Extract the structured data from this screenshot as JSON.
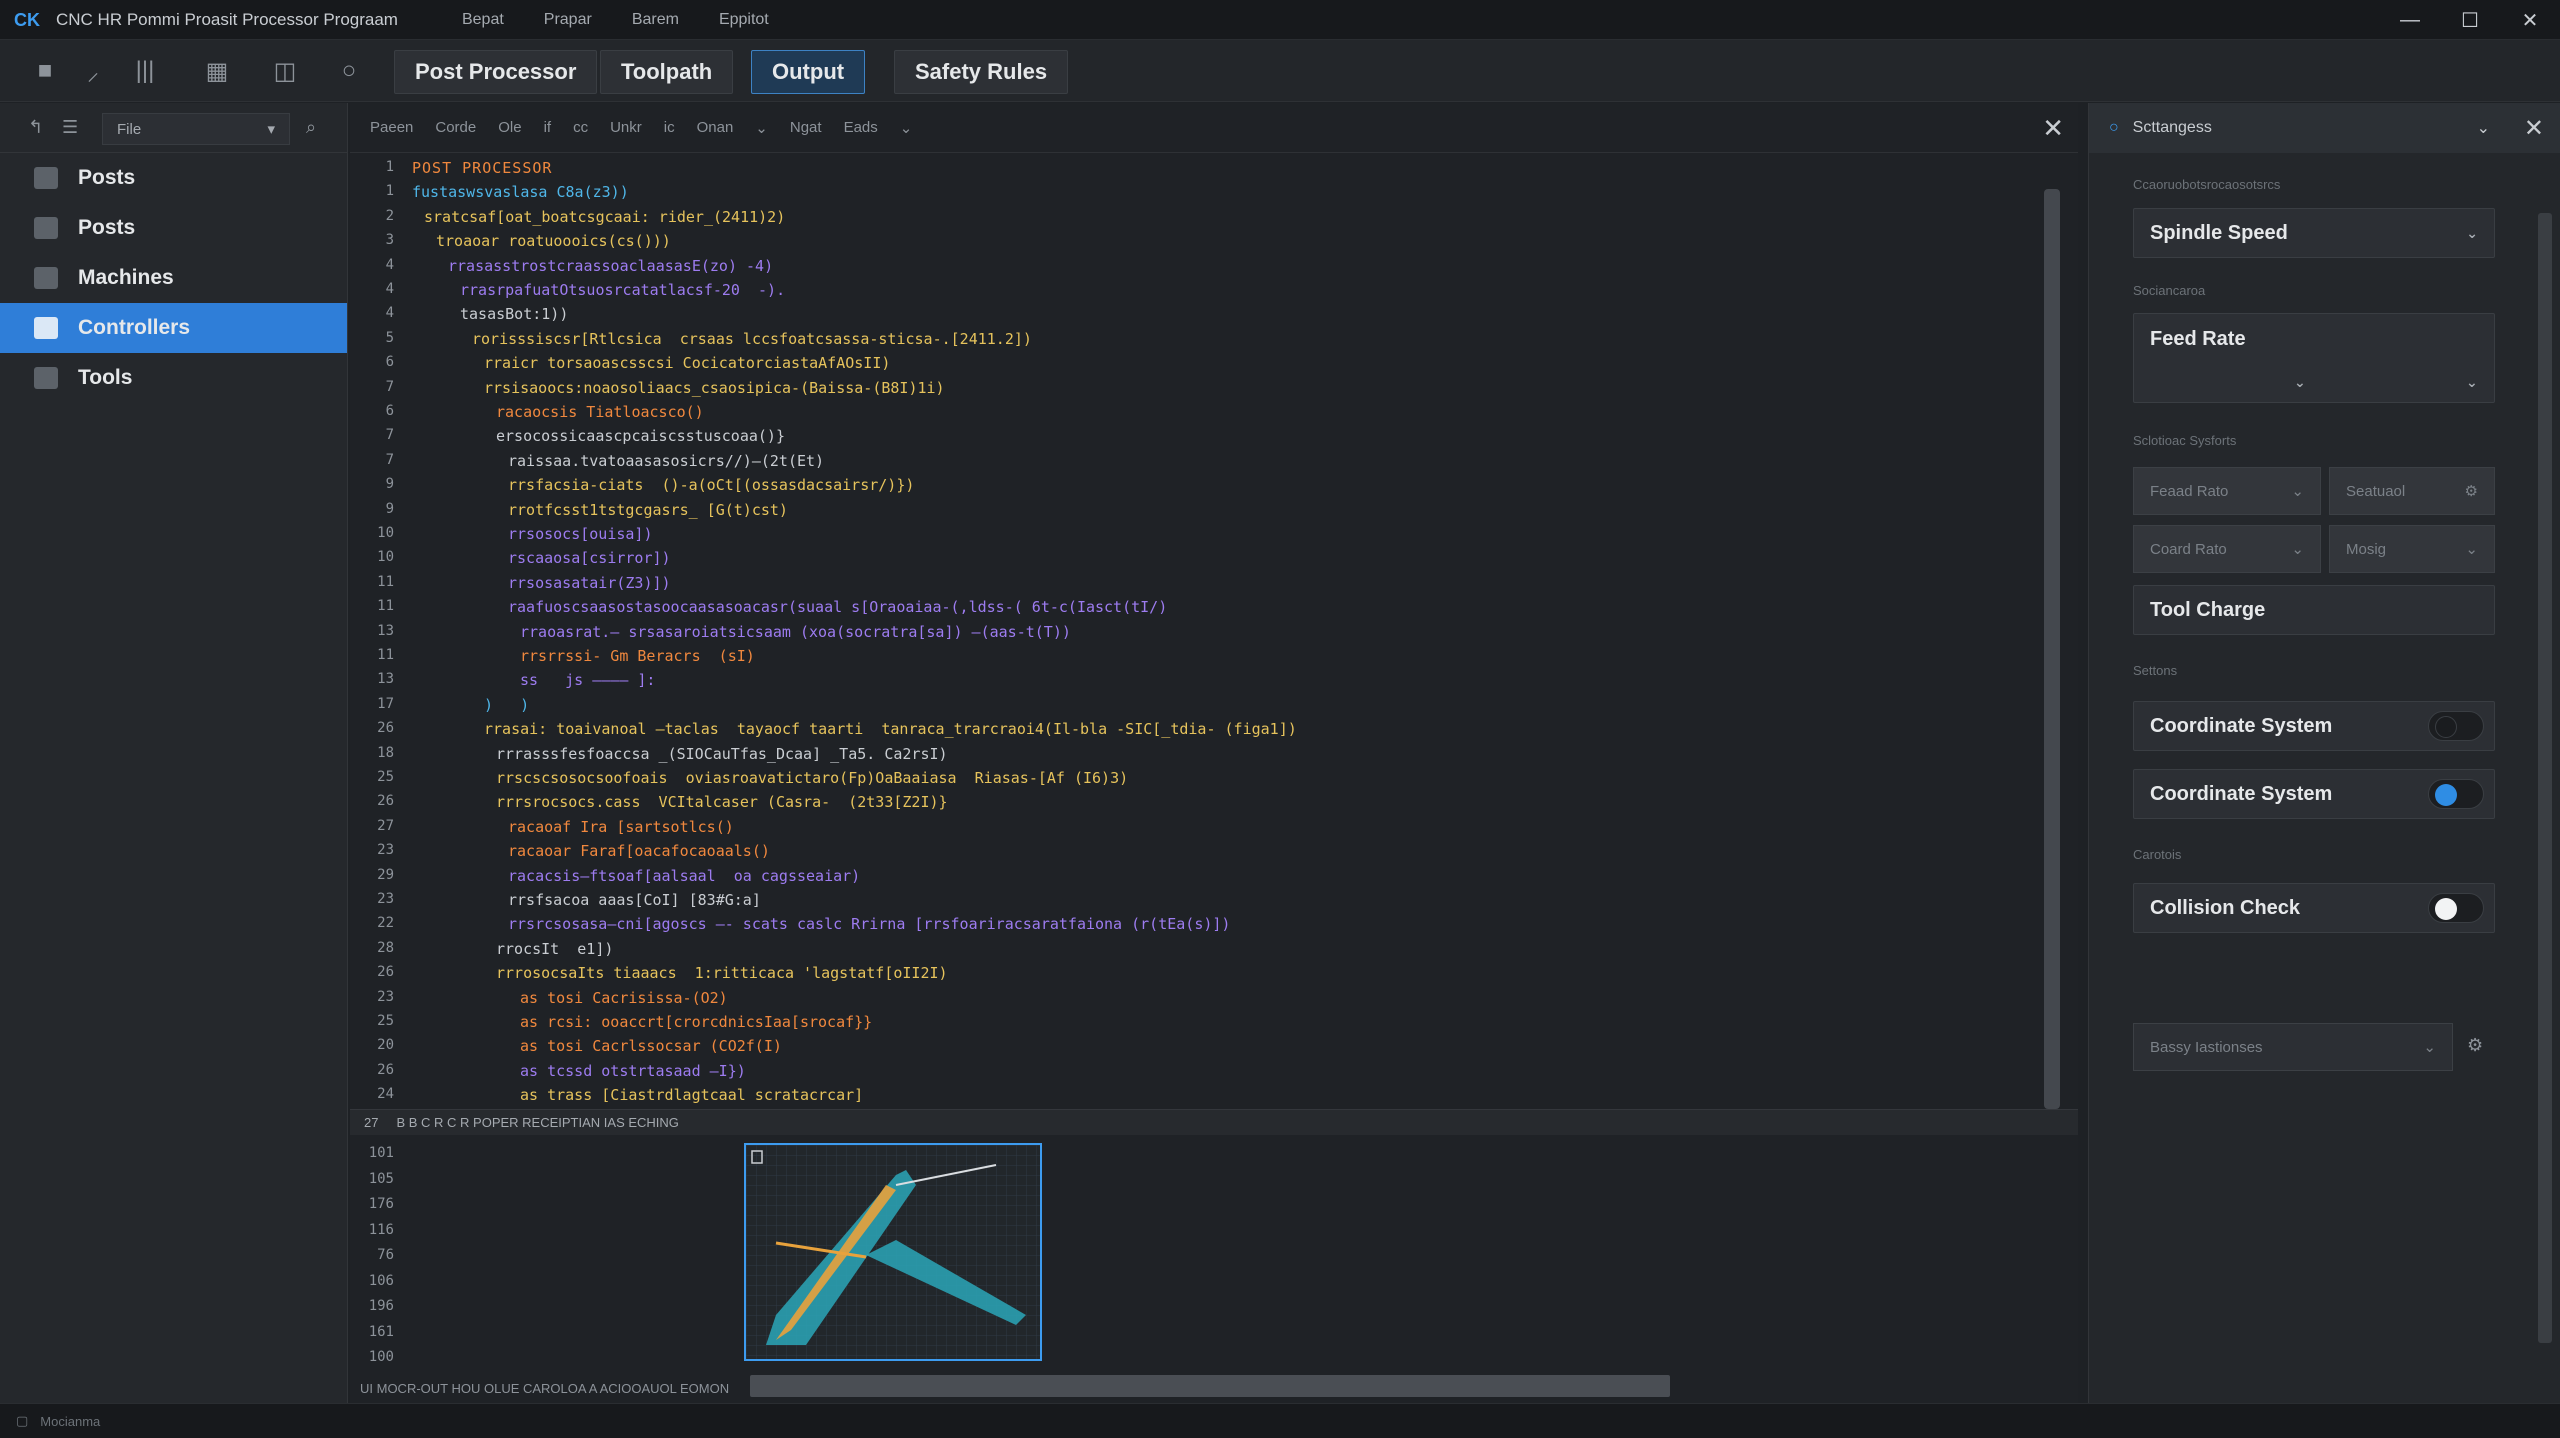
{
  "titlebar": {
    "title": "CNC HR Pommi Proasit Processor Prograam",
    "menu": [
      "Bepat",
      "Prapar",
      "Barem",
      "Eppitot"
    ],
    "minimize": "—",
    "maximize": "☐",
    "close": "✕"
  },
  "tabs": [
    {
      "label": "Post Processor",
      "active": false
    },
    {
      "label": "Toolpath",
      "active": false
    },
    {
      "label": "Output",
      "active": true
    },
    {
      "label": "Safety Rules",
      "active": false
    }
  ],
  "sidebar": {
    "file_select": "File",
    "items": [
      {
        "label": "Posts",
        "active": false
      },
      {
        "label": "Posts",
        "active": false
      },
      {
        "label": "Machines",
        "active": false
      },
      {
        "label": "Controllers",
        "active": true
      },
      {
        "label": "Tools",
        "active": false
      }
    ]
  },
  "editor": {
    "toolbar": [
      "Paeen",
      "Corde",
      "Ole",
      "if",
      "cc",
      "Unkr",
      "ic",
      "Onan",
      "Ngat",
      "Eads"
    ],
    "line_numbers": [
      "1",
      "1",
      "2",
      "3",
      "4",
      "4",
      "4",
      "5",
      "6",
      "7",
      "6",
      "7",
      "7",
      "9",
      "9",
      "10",
      "10",
      "11",
      "11",
      "13",
      "11",
      "13",
      "17",
      "26",
      "18",
      "25",
      "26",
      "27",
      "23",
      "29",
      "23",
      "22",
      "28",
      "26",
      "23",
      "25",
      "20",
      "26",
      "24"
    ],
    "lines": [
      {
        "text": "POST PROCESSOR",
        "cls": "c-head",
        "indent": 0
      },
      {
        "text": "fustaswsvaslasa C8a(z3))",
        "cls": "c-a",
        "indent": 0
      },
      {
        "text": "sratcsaf[oat_boatcsgcaai: rider_(2411)2)",
        "cls": "c-b",
        "indent": 1
      },
      {
        "text": "troaoar roatuoooics(cs()))",
        "cls": "c-b",
        "indent": 2
      },
      {
        "text": "rrasasstrostcraassoaclaasasE(zo) -4)",
        "cls": "c-c",
        "indent": 3
      },
      {
        "text": "rrasrpafuatOtsuosrcatatlacsf-20  -).",
        "cls": "c-c",
        "indent": 4
      },
      {
        "text": "tasasBot:1))",
        "cls": "c-d",
        "indent": 4
      },
      {
        "text": "rorisssiscsr[Rtlcsica  crsaas lccsfoatcsassa-sticsa-.[2411.2])",
        "cls": "c-b",
        "indent": 5
      },
      {
        "text": "rraicr torsaoascsscsi CocicatorciastaAfAOsII)",
        "cls": "c-b",
        "indent": 6
      },
      {
        "text": "rrsisaoocs:noaosoliaacs_csaosipica-(Baissa-(B8I)1i)",
        "cls": "c-b",
        "indent": 6
      },
      {
        "text": "racaocsis Tiatloacsco()",
        "cls": "c-e",
        "indent": 7
      },
      {
        "text": "ersocossicaascpcaiscsstuscoaa()}",
        "cls": "c-d",
        "indent": 7
      },
      {
        "text": "raissaa.tvatoaasasosicrs//)—(2t(Et)",
        "cls": "c-d",
        "indent": 8
      },
      {
        "text": "rrsfacsia-ciats  ()-a(oCt[(ossasdacsairsr/)})",
        "cls": "c-b",
        "indent": 8
      },
      {
        "text": "rrotfcsst1tstgcgasrs_ [G(t)cst)",
        "cls": "c-b",
        "indent": 8
      },
      {
        "text": "rrsosocs[ouisa])",
        "cls": "c-c",
        "indent": 8
      },
      {
        "text": "rscaaosa[csirror])",
        "cls": "c-c",
        "indent": 8
      },
      {
        "text": "rrsosasatair(Z3)])",
        "cls": "c-c",
        "indent": 8
      },
      {
        "text": "raafuoscsaasostasoocaasasoacasr(suaal s[Oraoaiaa-(,ldss-( 6t-c(Iasct(tI/)",
        "cls": "c-c",
        "indent": 8
      },
      {
        "text": "rraoasrat.— srsasaroiatsicsaam (xoa(socratra[sa]) —(aas-t(T))",
        "cls": "c-c",
        "indent": 9
      },
      {
        "text": "rrsrrssi- Gm Beracrs  (sI)",
        "cls": "c-e",
        "indent": 9
      },
      {
        "text": "ss   js ———— ]:",
        "cls": "c-c",
        "indent": 9
      },
      {
        "text": ")   )",
        "cls": "c-a",
        "indent": 6
      },
      {
        "text": "rrasai: toaivanoal —taclas  tayaocf taarti  tanraca_trarcraoi4(Il-bla -SIC[_tdia- (figa1])",
        "cls": "c-b",
        "indent": 6
      },
      {
        "text": "rrrasssfesfoaccsa _(SIOCauTfas_Dcaa] _Ta5. Ca2rsI)",
        "cls": "c-d",
        "indent": 7
      },
      {
        "text": "rrscscsosocsoofoais  oviasroavatictaro(Fp)OaBaaiasa  Riasas-[Af (I6)3)",
        "cls": "c-b",
        "indent": 7
      },
      {
        "text": "rrrsrocsocs.cass  VCItalcaser (Casra-  (2t33[Z2I)}",
        "cls": "c-b",
        "indent": 7
      },
      {
        "text": "racaoaf Ira [sartsotlcs()",
        "cls": "c-e",
        "indent": 8
      },
      {
        "text": "racaoar Faraf[oacafocaoaals()",
        "cls": "c-e",
        "indent": 8
      },
      {
        "text": "racacsis—ftsoaf[aalsaal  oa cagsseaiar)",
        "cls": "c-c",
        "indent": 8
      },
      {
        "text": "rrsfsacoa aaas[CoI] [83#G:a]",
        "cls": "c-d",
        "indent": 8
      },
      {
        "text": "rrsrcsosasa—cni[agoscs —- scats caslc Rrirna [rrsfoariracsaratfaiona (r(tEa(s)])",
        "cls": "c-c",
        "indent": 8
      },
      {
        "text": "rrocsIt  e1])",
        "cls": "c-d",
        "indent": 7
      },
      {
        "text": "rrrosocsaIts tiaaacs  1:ritticaca 'lagstatf[oII2I)",
        "cls": "c-b",
        "indent": 7
      },
      {
        "text": "as tosi Cacrisissa-(O2)",
        "cls": "c-e",
        "indent": 9
      },
      {
        "text": "as rcsi: ooaccrt[crorcdnicsIaa[srocaf}}",
        "cls": "c-e",
        "indent": 9
      },
      {
        "text": "as tosi Cacrlssocsar (CO2f(I)",
        "cls": "c-e",
        "indent": 9
      },
      {
        "text": "as tcssd otstrtasaad —I})",
        "cls": "c-c",
        "indent": 9
      },
      {
        "text": "as trass [Ciastrdlagtcaal scratacrcar]",
        "cls": "c-b",
        "indent": 9
      }
    ],
    "status_mid": "B B C R C R POPER RECEIPTIAN IAS ECHING",
    "lower_line_numbers": [
      "27",
      "101",
      "105",
      "176",
      "116",
      "76",
      "106",
      "196",
      "161",
      "100"
    ],
    "footer": "UI MOCR-OUT HOU OLUE   CAROLOA A ACIOOAUOL EOMON"
  },
  "right_panel": {
    "header": "Scttangess",
    "section_top_label": "Ccaoruobotsrocaosotsrcs",
    "spindle_speed": "Spindle Speed",
    "label_2": "Sociancaroa",
    "feed_rate": "Feed Rate",
    "label_3": "Sclotioac Sysforts",
    "small_1": "Feaad Rato",
    "small_2": "Seatuaol",
    "small_3": "Coard Rato",
    "small_4": "Mosig",
    "tool_change": "Tool Charge",
    "label_4": "Settons",
    "coord_1": "Coordinate System",
    "coord_2": "Coordinate System",
    "label_5": "Carotois",
    "collision": "Collision Check",
    "bottom_select": "Bassy Iastionses",
    "toggle_colors": {
      "off": "#1c1e21",
      "on": "#2f8de4"
    }
  },
  "statusbar": {
    "text": "Mocianma"
  }
}
